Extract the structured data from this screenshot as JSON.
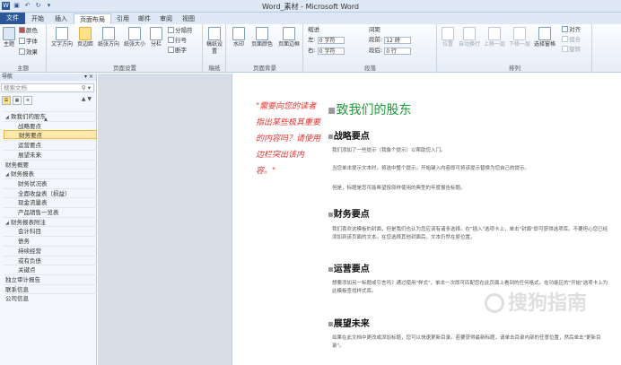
{
  "title": "Word_素材 - Microsoft Word",
  "tabs": [
    "文件",
    "开始",
    "插入",
    "页面布局",
    "引用",
    "邮件",
    "审阅",
    "视图"
  ],
  "ribbon": {
    "theme_group": {
      "label": "主题",
      "btn": "主题",
      "colors": "颜色",
      "fonts": "字体",
      "effects": "效果"
    },
    "page_setup": {
      "label": "页面设置",
      "text_dir": "文字方向",
      "margins": "页边距",
      "orientation": "纸张方向",
      "size": "纸张大小",
      "columns": "分栏",
      "breaks": "分隔符",
      "line_numbers": "行号",
      "hyphenation": "断字"
    },
    "paper": {
      "label": "稿纸",
      "btn": "稿纸设置"
    },
    "bg": {
      "label": "页面背景",
      "watermark": "水印",
      "page_color": "页面颜色",
      "page_border": "页面边框"
    },
    "para": {
      "label": "段落",
      "indent": "缩进",
      "spacing": "间距",
      "left": "左:",
      "right": "右:",
      "before": "段前:",
      "after": "段后:",
      "left_val": "0 字符",
      "right_val": "0 字符",
      "before_val": "12 磅",
      "after_val": "0 行"
    },
    "arrange": {
      "label": "排列",
      "position": "位置",
      "wrap": "自动换行",
      "forward": "上移一层",
      "backward": "下移一层",
      "sel_pane": "选择窗格",
      "align": "对齐",
      "group": "组合",
      "rotate": "旋转"
    }
  },
  "nav": {
    "title": "导航",
    "search_placeholder": "搜索文档",
    "items": [
      {
        "label": "致我们的股东",
        "level": 0,
        "twisty": "◢"
      },
      {
        "label": "战略要点",
        "level": 1
      },
      {
        "label": "财务要点",
        "level": 1,
        "selected": true
      },
      {
        "label": "运营要点",
        "level": 1
      },
      {
        "label": "展望未来",
        "level": 1
      },
      {
        "label": "财务概要",
        "level": 0
      },
      {
        "label": "财务报表",
        "level": 0,
        "twisty": "◢"
      },
      {
        "label": "财务状况表",
        "level": 1
      },
      {
        "label": "全面收益表（损益）",
        "level": 1
      },
      {
        "label": "现金流量表",
        "level": 1
      },
      {
        "label": "产品销售一览表",
        "level": 1
      },
      {
        "label": "财务报表附注",
        "level": 0,
        "twisty": "◢"
      },
      {
        "label": "会计科目",
        "level": 1
      },
      {
        "label": "债务",
        "level": 1
      },
      {
        "label": "持续经营",
        "level": 1
      },
      {
        "label": "或有负债",
        "level": 1
      },
      {
        "label": "关键点",
        "level": 1
      },
      {
        "label": "独立审计报告",
        "level": 0
      },
      {
        "label": "联系信息",
        "level": 0
      },
      {
        "label": "公司信息",
        "level": 0
      }
    ]
  },
  "doc": {
    "side_quote": "\"需要向您的读者指出某些极其重要的内容吗？请使用边栏突出该内容。\"",
    "heading": "致我们的股东",
    "sections": [
      {
        "title": "战略要点",
        "paras": [
          "我们添加了一些提示（我像个提示）以帮助您入门。",
          "当您单击提示文本时，将选中整个提示。开始键入内容即可将该提示替换为您自己的提示。",
          "但是，标题是您可能希望按原样使用的典型的年度报告标题。"
        ]
      },
      {
        "title": "财务要点",
        "paras": [
          "我们喜欢这模板的封面，但是我们也认为您应该有诸多选择。在\"插入\"选项卡上，单击\"封面\"即可获得选项库。不要担心您已经添加到该页面的文本。在您选择其他封面后，文本仍然在原位置。"
        ]
      },
      {
        "title": "运营要点",
        "paras": [
          "想要添加另一标题或引言吗？通过使用\"样式\"，单击一次即可匹配您在此页面上看到的任何格式。在功能区的\"开始\"选项卡上为此模板查找样式库。"
        ]
      },
      {
        "title": "展望未来",
        "paras": [
          "如果在此文档中更改或添加标题，您可以快速更新目录。若要获得最新标题，请单击目录内部的任意位置，然后单击\"更新目录\"。"
        ]
      }
    ]
  },
  "watermark": "搜狗指南"
}
